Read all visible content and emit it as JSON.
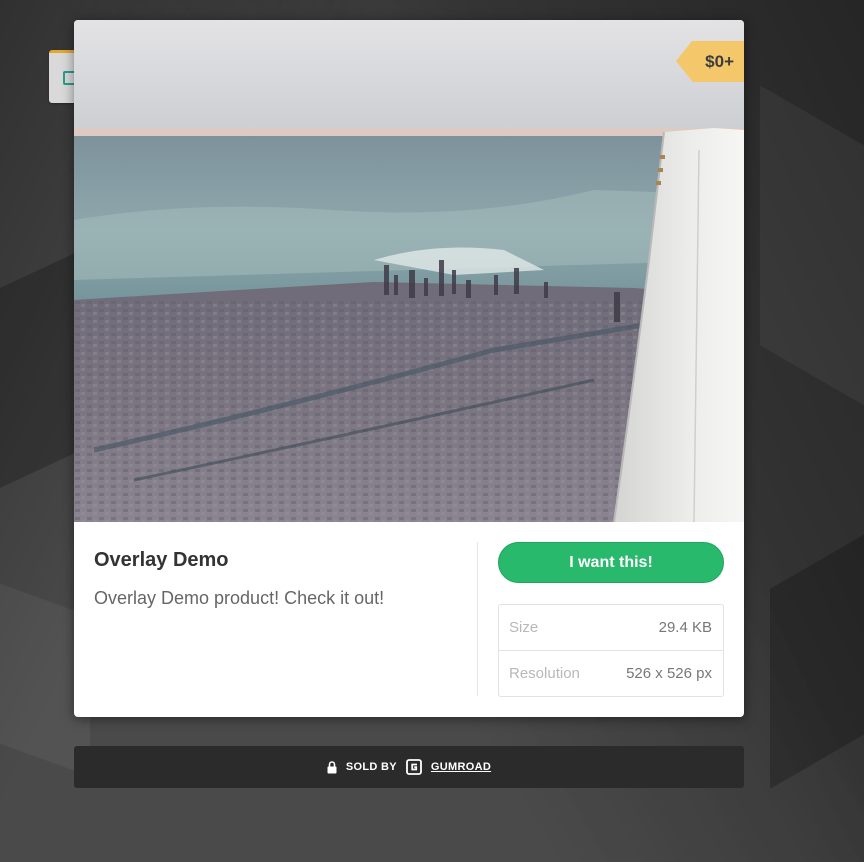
{
  "product": {
    "title": "Overlay Demo",
    "description": "Overlay Demo product! Check it out!",
    "price": "$0+",
    "buy_label": "I want this!"
  },
  "details": [
    {
      "key": "Size",
      "value": "29.4 KB"
    },
    {
      "key": "Resolution",
      "value": "526 x 526 px"
    }
  ],
  "footer": {
    "sold_by_label": "SOLD BY",
    "brand_link": "GUMROAD",
    "lock_icon": "lock-icon",
    "brand_icon": "gumroad-logo-icon"
  },
  "colors": {
    "buy_button": "#29b96d",
    "price_tag": "#f5c76b",
    "footer_bar": "#2b2b2b"
  }
}
